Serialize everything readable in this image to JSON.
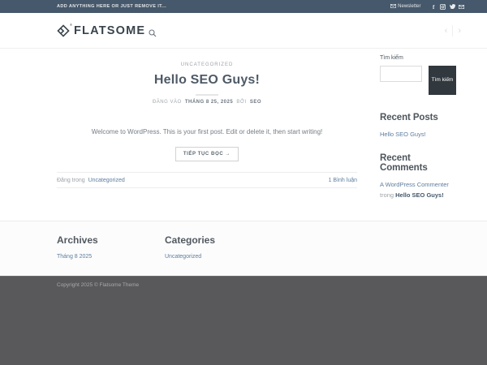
{
  "topbar": {
    "left_text": "ADD ANYTHING HERE OR JUST REMOVE IT...",
    "newsletter_label": "Newsletter",
    "social_icons": [
      "facebook",
      "instagram",
      "twitter",
      "email"
    ]
  },
  "header": {
    "logo_text": "FLATSOME",
    "logo_reg_mark": "®",
    "nav_prev": "‹",
    "nav_next": "›"
  },
  "post": {
    "category": "UNCATEGORIZED",
    "title": "Hello SEO Guys!",
    "byline": {
      "prefix": "ĐĂNG VÀO",
      "date": "THÁNG 8 25, 2025",
      "by": "BỞI",
      "author": "SEO"
    },
    "excerpt": "Welcome to WordPress. This is your first post. Edit or delete it, then start writing!",
    "read_more_label": "TIẾP TỤC ĐỌC →",
    "meta": {
      "posted_in": "Đăng trong",
      "category_link": "Uncategorized",
      "comments_link": "1 Bình luận"
    }
  },
  "sidebar": {
    "search": {
      "label": "Tìm kiếm",
      "input_value": "",
      "button_label": "Tìm kiếm"
    },
    "recent_posts": {
      "title": "Recent Posts",
      "items": [
        "Hello SEO Guys!"
      ]
    },
    "recent_comments": {
      "title": "Recent Comments",
      "author": "A WordPress Commenter",
      "on_word": "trong",
      "post": "Hello SEO Guys!"
    }
  },
  "footer": {
    "archives": {
      "title": "Archives",
      "items": [
        "Tháng 8 2025"
      ]
    },
    "categories": {
      "title": "Categories",
      "items": [
        "Uncategorized"
      ]
    },
    "copyright": "Copyright 2025 © Flatsome Theme"
  },
  "colors": {
    "topbar_bg": "#46586b",
    "link_accent": "#5e7d9e",
    "search_button_bg": "#31383e",
    "footer_bg": "#59595b",
    "heading": "#4e5a66"
  }
}
